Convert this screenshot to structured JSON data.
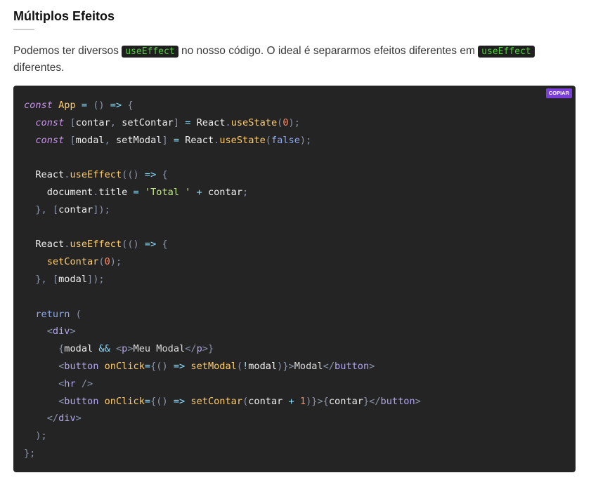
{
  "heading": {
    "title": "Múltiplos Efeitos"
  },
  "intro": {
    "part1": "Podemos ter diversos ",
    "code1": "useEffect",
    "part2": " no nosso código. O ideal é separarmos efeitos diferentes em ",
    "code2": "useEffect",
    "part3": " diferentes."
  },
  "code_block": {
    "copy_label": "COPIAR",
    "lines": [
      [
        [
          "keyword",
          "const"
        ],
        [
          "id",
          " "
        ],
        [
          "fn",
          "App"
        ],
        [
          "op",
          " = "
        ],
        [
          "punc",
          "()"
        ],
        [
          "op",
          " => "
        ],
        [
          "punc",
          "{"
        ]
      ],
      [
        [
          "id",
          "  "
        ],
        [
          "keyword",
          "const"
        ],
        [
          "id",
          " "
        ],
        [
          "punc",
          "["
        ],
        [
          "id",
          "contar"
        ],
        [
          "punc",
          ", "
        ],
        [
          "id",
          "setContar"
        ],
        [
          "punc",
          "]"
        ],
        [
          "op",
          " = "
        ],
        [
          "id",
          "React"
        ],
        [
          "punc",
          "."
        ],
        [
          "call",
          "useState"
        ],
        [
          "punc",
          "("
        ],
        [
          "num",
          "0"
        ],
        [
          "punc",
          ");"
        ]
      ],
      [
        [
          "id",
          "  "
        ],
        [
          "keyword",
          "const"
        ],
        [
          "id",
          " "
        ],
        [
          "punc",
          "["
        ],
        [
          "id",
          "modal"
        ],
        [
          "punc",
          ", "
        ],
        [
          "id",
          "setModal"
        ],
        [
          "punc",
          "]"
        ],
        [
          "op",
          " = "
        ],
        [
          "id",
          "React"
        ],
        [
          "punc",
          "."
        ],
        [
          "call",
          "useState"
        ],
        [
          "punc",
          "("
        ],
        [
          "bool",
          "false"
        ],
        [
          "punc",
          ");"
        ]
      ],
      [],
      [
        [
          "id",
          "  React"
        ],
        [
          "punc",
          "."
        ],
        [
          "call",
          "useEffect"
        ],
        [
          "punc",
          "(()"
        ],
        [
          "op",
          " => "
        ],
        [
          "punc",
          "{"
        ]
      ],
      [
        [
          "id",
          "    document"
        ],
        [
          "punc",
          "."
        ],
        [
          "id",
          "title"
        ],
        [
          "op",
          " = "
        ],
        [
          "str",
          "'Total '"
        ],
        [
          "op",
          " + "
        ],
        [
          "id",
          "contar"
        ],
        [
          "punc",
          ";"
        ]
      ],
      [
        [
          "punc",
          "  }, ["
        ],
        [
          "id",
          "contar"
        ],
        [
          "punc",
          "]);"
        ]
      ],
      [],
      [
        [
          "id",
          "  React"
        ],
        [
          "punc",
          "."
        ],
        [
          "call",
          "useEffect"
        ],
        [
          "punc",
          "(()"
        ],
        [
          "op",
          " => "
        ],
        [
          "punc",
          "{"
        ]
      ],
      [
        [
          "id",
          "    "
        ],
        [
          "call",
          "setContar"
        ],
        [
          "punc",
          "("
        ],
        [
          "num",
          "0"
        ],
        [
          "punc",
          ");"
        ]
      ],
      [
        [
          "punc",
          "  }, ["
        ],
        [
          "id",
          "modal"
        ],
        [
          "punc",
          "]);"
        ]
      ],
      [],
      [
        [
          "id",
          "  "
        ],
        [
          "ret",
          "return"
        ],
        [
          "punc",
          " ("
        ]
      ],
      [
        [
          "punc",
          "    <"
        ],
        [
          "tag",
          "div"
        ],
        [
          "punc",
          ">"
        ]
      ],
      [
        [
          "punc",
          "      {"
        ],
        [
          "id",
          "modal"
        ],
        [
          "op",
          " && "
        ],
        [
          "punc",
          "<"
        ],
        [
          "tag",
          "p"
        ],
        [
          "punc",
          ">"
        ],
        [
          "text",
          "Meu Modal"
        ],
        [
          "punc",
          "</"
        ],
        [
          "tag",
          "p"
        ],
        [
          "punc",
          ">}"
        ]
      ],
      [
        [
          "punc",
          "      <"
        ],
        [
          "tag",
          "button"
        ],
        [
          "id",
          " "
        ],
        [
          "attr",
          "onClick"
        ],
        [
          "op",
          "="
        ],
        [
          "punc",
          "{()"
        ],
        [
          "op",
          " => "
        ],
        [
          "call",
          "setModal"
        ],
        [
          "punc",
          "("
        ],
        [
          "op",
          "!"
        ],
        [
          "id",
          "modal"
        ],
        [
          "punc",
          ")}>"
        ],
        [
          "text",
          "Modal"
        ],
        [
          "punc",
          "</"
        ],
        [
          "tag",
          "button"
        ],
        [
          "punc",
          ">"
        ]
      ],
      [
        [
          "punc",
          "      <"
        ],
        [
          "tag",
          "hr"
        ],
        [
          "punc",
          " />"
        ]
      ],
      [
        [
          "punc",
          "      <"
        ],
        [
          "tag",
          "button"
        ],
        [
          "id",
          " "
        ],
        [
          "attr",
          "onClick"
        ],
        [
          "op",
          "="
        ],
        [
          "punc",
          "{()"
        ],
        [
          "op",
          " => "
        ],
        [
          "call",
          "setContar"
        ],
        [
          "punc",
          "("
        ],
        [
          "id",
          "contar"
        ],
        [
          "op",
          " + "
        ],
        [
          "num",
          "1"
        ],
        [
          "punc",
          ")}>{"
        ],
        [
          "id",
          "contar"
        ],
        [
          "punc",
          "}</"
        ],
        [
          "tag",
          "button"
        ],
        [
          "punc",
          ">"
        ]
      ],
      [
        [
          "punc",
          "    </"
        ],
        [
          "tag",
          "div"
        ],
        [
          "punc",
          ">"
        ]
      ],
      [
        [
          "punc",
          "  );"
        ]
      ],
      [
        [
          "punc",
          "};"
        ]
      ]
    ]
  }
}
